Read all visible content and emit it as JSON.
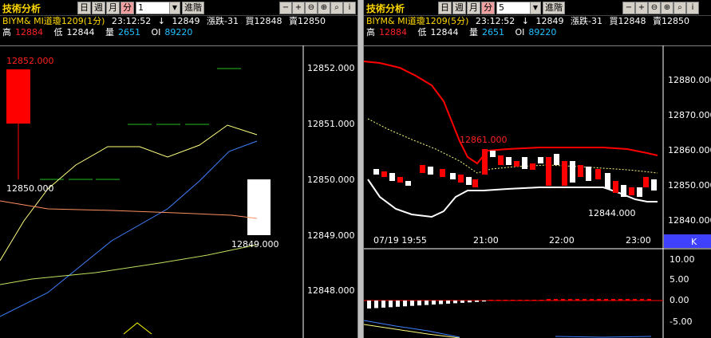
{
  "left": {
    "title": "技術分析",
    "period_buttons": [
      "日",
      "週",
      "月",
      "分"
    ],
    "active_period": "分",
    "interval_value": "1",
    "advance_label": "進階",
    "symbol_line": "BIYM& MI道瓊1209(1分)",
    "time": "23:12:52",
    "arrow": "↓",
    "last": "12849",
    "change": "漲跌-31",
    "bid": "買12848",
    "ask": "賣12850",
    "high_label": "高",
    "high": "12884",
    "low_label": "低",
    "low": "12844",
    "vol_label": "量",
    "vol": "2651",
    "oi_label": "OI",
    "oi": "89220",
    "y_axis": [
      "12852.000",
      "12851.000",
      "12850.000",
      "12849.000",
      "12848.000"
    ],
    "annotations": {
      "high_label": "12852.000",
      "mid_label": "12850.000",
      "low_label": "12849.000"
    }
  },
  "right": {
    "title": "技術分析",
    "period_buttons": [
      "日",
      "週",
      "月",
      "分"
    ],
    "active_period": "分",
    "interval_value": "5",
    "advance_label": "進階",
    "symbol_line": "BIYM& MI道瓊1209(5分)",
    "time": "23:12:52",
    "arrow": "↓",
    "last": "12849",
    "change": "漲跌-31",
    "bid": "買12848",
    "ask": "賣12850",
    "high_label": "高",
    "high": "12884",
    "low_label": "低",
    "low": "12844",
    "vol_label": "量",
    "vol": "2651",
    "oi_label": "OI",
    "oi": "89220",
    "y_axis": [
      "12880.000",
      "12870.000",
      "12860.000",
      "12850.000",
      "12840.000"
    ],
    "x_axis": [
      "07/19 19:55",
      "21:00",
      "22:00",
      "23:00"
    ],
    "k_label": "K",
    "annotations": {
      "high_label": "12861.000",
      "low_label": "12844.000"
    },
    "sub_y_axis": [
      "10.00",
      "5.00",
      "0.00",
      "-5.00"
    ]
  },
  "colors": {
    "up": "#ff0000",
    "down": "#ffffff",
    "accent": "#ffd800",
    "upper_band": "#ff0000",
    "lower_band": "#ffffff",
    "mid_band": "#ffff80"
  }
}
